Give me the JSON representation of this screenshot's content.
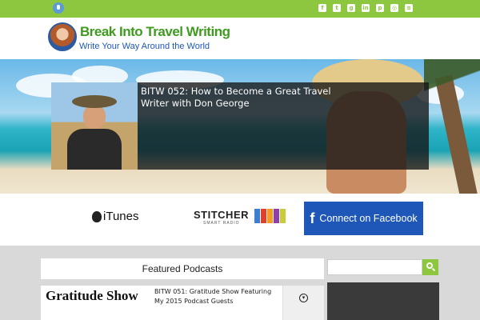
{
  "header": {
    "title": "Break Into Travel Writing",
    "tagline": "Write Your Way Around the World"
  },
  "topbar": {
    "social_icons": [
      "facebook-icon",
      "twitter-icon",
      "google-plus-icon",
      "linkedin-icon",
      "pinterest-icon",
      "instagram-icon",
      "rss-icon"
    ],
    "social_glyphs": [
      "f",
      "t",
      "g",
      "in",
      "p",
      "◎",
      "≋"
    ]
  },
  "hero": {
    "post_title": "BITW 052: How to Become a Great Travel Writer with Don George"
  },
  "podcast_links": {
    "itunes_label": "iTunes",
    "stitcher_label": "STITCHER",
    "stitcher_sub": "SMART RADIO",
    "facebook_glyph": "f",
    "facebook_label": "Connect on Facebook"
  },
  "featured": {
    "heading": "Featured Podcasts",
    "episodes": [
      {
        "thumb_text": "Gratitude Show",
        "title": "BITW 051: Gratitude Show Featuring My 2015 Podcast Guests"
      }
    ]
  },
  "colors": {
    "brand_green": "#8dc63f",
    "title_green": "#3f9b1f",
    "tagline_blue": "#1e57b5",
    "facebook_blue": "#1f57b9"
  }
}
